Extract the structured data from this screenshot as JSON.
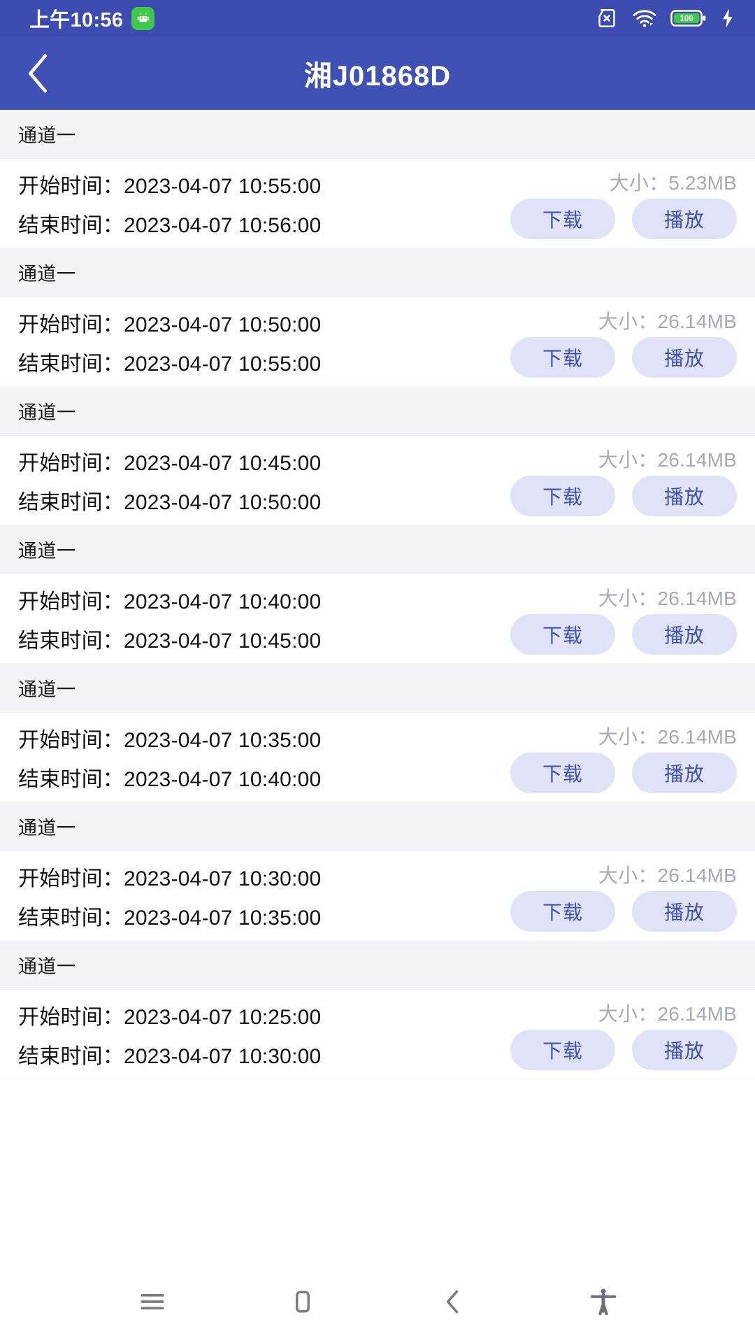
{
  "status_bar": {
    "time": "上午10:56",
    "app_icon": "android-robot-icon",
    "icons": [
      "sim-card-off-icon",
      "wifi-icon",
      "battery-icon",
      "charging-bolt-icon"
    ],
    "battery_level": "100",
    "background_color": "#3C4BAF"
  },
  "app_bar": {
    "back_icon": "chevron-left-icon",
    "title": "湘J01868D",
    "background_color": "#3F51B5"
  },
  "labels": {
    "start_time": "开始时间：",
    "end_time": "结束时间：",
    "size": "大小：",
    "download": "下载",
    "play": "播放"
  },
  "theme": {
    "accent": "#3F51B5",
    "pill_background": "#E0E3F7",
    "group_header_background": "#F4F4F8",
    "size_text_color": "#A9A9B3"
  },
  "recordings": [
    {
      "channel": "通道一",
      "start_time": "2023-04-07 10:55:00",
      "end_time": "2023-04-07 10:56:00",
      "size": "5.23MB"
    },
    {
      "channel": "通道一",
      "start_time": "2023-04-07 10:50:00",
      "end_time": "2023-04-07 10:55:00",
      "size": "26.14MB"
    },
    {
      "channel": "通道一",
      "start_time": "2023-04-07 10:45:00",
      "end_time": "2023-04-07 10:50:00",
      "size": "26.14MB"
    },
    {
      "channel": "通道一",
      "start_time": "2023-04-07 10:40:00",
      "end_time": "2023-04-07 10:45:00",
      "size": "26.14MB"
    },
    {
      "channel": "通道一",
      "start_time": "2023-04-07 10:35:00",
      "end_time": "2023-04-07 10:40:00",
      "size": "26.14MB"
    },
    {
      "channel": "通道一",
      "start_time": "2023-04-07 10:30:00",
      "end_time": "2023-04-07 10:35:00",
      "size": "26.14MB"
    },
    {
      "channel": "通道一",
      "start_time": "2023-04-07 10:25:00",
      "end_time": "2023-04-07 10:30:00",
      "size": "26.14MB"
    }
  ],
  "nav_bar": {
    "items": [
      {
        "icon": "menu-icon"
      },
      {
        "icon": "home-square-icon"
      },
      {
        "icon": "back-chevron-icon"
      },
      {
        "icon": "accessibility-person-icon"
      }
    ]
  }
}
